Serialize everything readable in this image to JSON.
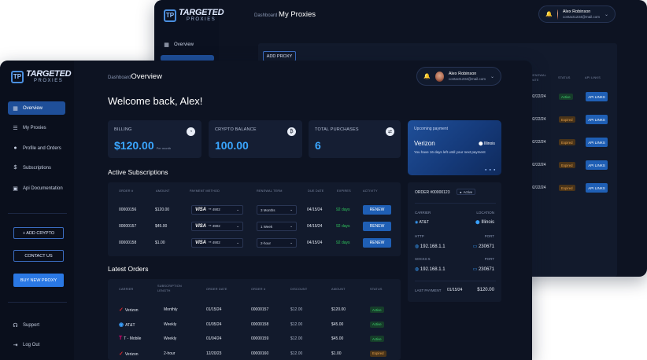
{
  "brand": {
    "line1": "TARGETED",
    "line2": "PROXIES",
    "mark": "TP"
  },
  "back": {
    "crumb": "Dashboard",
    "title": "My Proxies",
    "user_name": "Alex Robinson",
    "user_email": "contact1234@mail.com",
    "nav_overview": "Overview",
    "add_proxy": "ADD PROXY",
    "col_renewal_date": "RENEWAL DATE",
    "col_status": "STATUS",
    "col_api": "API LINKS",
    "rows": [
      {
        "date": "02/22/24",
        "status": "Active",
        "api": "API LINKS"
      },
      {
        "date": "02/22/24",
        "status": "Expired",
        "api": "API LINKS"
      },
      {
        "date": "02/22/24",
        "status": "Expired",
        "api": "API LINKS"
      },
      {
        "date": "02/22/24",
        "status": "Expired",
        "api": "API LINKS"
      },
      {
        "date": "02/22/24",
        "status": "Expired",
        "api": "API LINKS"
      }
    ]
  },
  "front": {
    "crumb": "Dashboard",
    "title": "Overview",
    "user_name": "Alex Robinson",
    "user_email": "contact1234@mail.com",
    "welcome": "Welcome back, Alex!",
    "nav": [
      "Overview",
      "My Proxies",
      "Profile and Orders",
      "Subscriptions",
      "Api Documentation"
    ],
    "add_crypto": "+ ADD CRYPTO",
    "contact_us": "CONTACT US",
    "buy_new_proxy": "BUY NEW PROXY",
    "support": "Support",
    "logout": "Log Out",
    "billing": {
      "label": "BILLING",
      "value": "$120.00",
      "sub": "Per month"
    },
    "crypto": {
      "label": "CRYPTO BALANCE",
      "value": "100.00"
    },
    "purchases": {
      "label": "TOTAL PURCHASES",
      "value": "6"
    },
    "upcoming": {
      "label": "Upcoming payment",
      "carrier": "Verizon",
      "location": "Illinois",
      "message": "You have 16 days left until your next payment"
    },
    "active_subs_title": "Active Subscriptions",
    "subs_headers": [
      "ORDER #",
      "AMOUNT",
      "PAYMENT METHOD",
      "RENEWAL TERM",
      "DUE DATE",
      "EXPIRES",
      "ACTIVITY"
    ],
    "subs": [
      {
        "order": "00000156",
        "amount": "$120.00",
        "card": "** 4902",
        "term": "3 Months",
        "due": "04/15/24",
        "expires": "92 days",
        "action": "RENEW"
      },
      {
        "order": "00000157",
        "amount": "$45.00",
        "card": "** 4902",
        "term": "1 Week",
        "due": "04/15/24",
        "expires": "92 days",
        "action": "RENEW"
      },
      {
        "order": "00000158",
        "amount": "$1.00",
        "card": "** 4902",
        "term": "2-hour",
        "due": "04/15/24",
        "expires": "92 days",
        "action": "RENEW"
      }
    ],
    "visa": "VISA",
    "latest_title": "Latest Orders",
    "orders_headers": [
      "CARRIER",
      "SUBSCRIPTION LENGTH",
      "ORDER DATE",
      "ORDER #",
      "DISCOUNT",
      "AMOUNT",
      "STATUS"
    ],
    "orders": [
      {
        "carrier": "Verizon",
        "length": "Monthly",
        "date": "01/15/24",
        "order": "00000157",
        "discount": "$12.00",
        "amount": "$120.00",
        "status": "Active"
      },
      {
        "carrier": "AT&T",
        "length": "Weekly",
        "date": "01/05/24",
        "order": "00000158",
        "discount": "$12.00",
        "amount": "$45.00",
        "status": "Active"
      },
      {
        "carrier": "T - Mobile",
        "length": "Weekly",
        "date": "01/04/24",
        "order": "00000159",
        "discount": "$12.00",
        "amount": "$45.00",
        "status": "Active"
      },
      {
        "carrier": "Verizon",
        "length": "2-hour",
        "date": "12/20/23",
        "order": "00000160",
        "discount": "$12.00",
        "amount": "$1.00",
        "status": "Expired"
      }
    ],
    "order_panel": {
      "order_label": "ORDER #00000123",
      "status": "Active",
      "carrier_label": "CARRIER",
      "location_label": "LOCATION",
      "carrier": "AT&T",
      "location": "Illinois",
      "http_label": "HTTP",
      "port_label": "PORT",
      "http_ip": "192.168.1.1",
      "http_port": "230671",
      "socks_label": "SOCKS 5",
      "socks_port_label": "PORT",
      "socks_ip": "192.168.1.1",
      "socks_port": "230671",
      "last_payment_label": "LAST PAYMENT",
      "last_payment_date": "01/15/24",
      "last_payment_amount": "$120.00"
    }
  }
}
